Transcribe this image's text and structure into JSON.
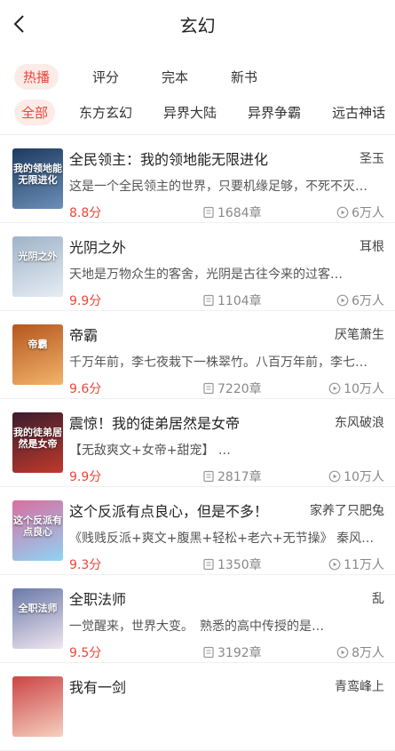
{
  "header": {
    "title": "玄幻"
  },
  "primary_tabs": [
    "热播",
    "评分",
    "完本",
    "新书"
  ],
  "category_tabs": [
    "全部",
    "东方玄幻",
    "异界大陆",
    "异界争霸",
    "远古神话"
  ],
  "books": [
    {
      "title": "全民领主：我的领地能无限进化",
      "author": "圣玉",
      "desc": "这是一个全民领主的世界，只要机缘足够，不死不灭…",
      "score": "8.8分",
      "chapters": "1684章",
      "reads": "6万人",
      "cover_text": "我的领地能无限进化",
      "cover_colors": [
        "#1e3a5f",
        "#6b8fb8"
      ]
    },
    {
      "title": "光阴之外",
      "author": "耳根",
      "desc": "天地是万物众生的客舍，光阴是古往今来的过客…",
      "score": "9.9分",
      "chapters": "1104章",
      "reads": "6万人",
      "cover_text": "光阴之外",
      "cover_colors": [
        "#9fb3c8",
        "#e6edf3"
      ]
    },
    {
      "title": "帝霸",
      "author": "厌笔萧生",
      "desc": "千万年前，李七夜栽下一株翠竹。八百万年前，李七…",
      "score": "9.6分",
      "chapters": "7220章",
      "reads": "10万人",
      "cover_text": "帝霸",
      "cover_colors": [
        "#b5561e",
        "#f2b46a"
      ]
    },
    {
      "title": "震惊！我的徒弟居然是女帝",
      "author": "东风破浪",
      "desc": "【无敌爽文+女帝+甜宠】 …",
      "score": "9.9分",
      "chapters": "2817章",
      "reads": "10万人",
      "cover_text": "我的徒弟居然是女帝",
      "cover_colors": [
        "#3a1c2e",
        "#c0392b"
      ]
    },
    {
      "title": "这个反派有点良心，但是不多！",
      "author": "家养了只肥兔",
      "desc": "《贱贱反派+爽文+腹黑+轻松+老六+无节操》 秦风…",
      "score": "9.3分",
      "chapters": "1350章",
      "reads": "11万人",
      "cover_text": "这个反派有点良心",
      "cover_colors": [
        "#d86fa0",
        "#8fd3f4"
      ]
    },
    {
      "title": "全职法师",
      "author": "乱",
      "desc": "一觉醒来，世界大变。　熟悉的高中传授的是…",
      "score": "9.5分",
      "chapters": "3192章",
      "reads": "8万人",
      "cover_text": "全职法师",
      "cover_colors": [
        "#6a7aa8",
        "#f0e6f0"
      ]
    },
    {
      "title": "我有一剑",
      "author": "青鸾峰上",
      "desc": "",
      "score": "",
      "chapters": "",
      "reads": "",
      "cover_text": "",
      "cover_colors": [
        "#c44",
        "#f6d0c0"
      ]
    }
  ],
  "icons": {
    "back": "chevron-left-icon",
    "chapters": "book-icon",
    "reads": "play-circle-icon"
  },
  "colors": {
    "accent": "#e8483a",
    "accent_bg": "#fdebe8",
    "muted": "#888888"
  }
}
